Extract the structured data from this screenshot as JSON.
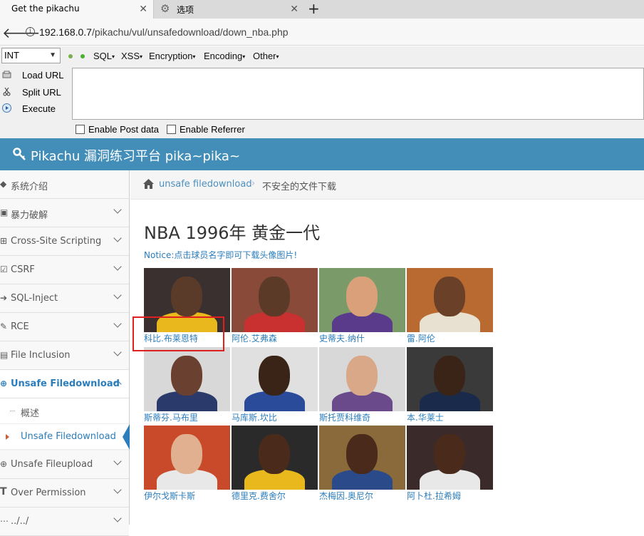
{
  "browser": {
    "tabs": [
      {
        "label": "Get the pikachu",
        "active": true
      },
      {
        "label": "选项",
        "active": false
      }
    ],
    "url_prefix": "192.168.0.7",
    "url_path": "/pikachu/vul/unsafedownload/down_nba.php"
  },
  "hackbar": {
    "select_value": "INT",
    "menus": [
      "SQL",
      "XSS",
      "Encryption",
      "Encoding",
      "Other"
    ],
    "buttons": [
      "Load URL",
      "Split URL",
      "Execute"
    ],
    "checkboxes": [
      "Enable Post data",
      "Enable Referrer"
    ]
  },
  "header": {
    "title": "Pikachu 漏洞练习平台 pika~pika~",
    "color": "#438eb9"
  },
  "sidebar": {
    "items": [
      {
        "label": "系统介绍",
        "icon": "tag-icon"
      },
      {
        "label": "暴力破解",
        "icon": "lock-icon"
      },
      {
        "label": "Cross-Site Scripting",
        "icon": "grid-icon"
      },
      {
        "label": "CSRF",
        "icon": "edit-icon"
      },
      {
        "label": "SQL-Inject",
        "icon": "arrow-icon"
      },
      {
        "label": "RCE",
        "icon": "pencil-icon"
      },
      {
        "label": "File Inclusion",
        "icon": "file-icon"
      },
      {
        "label": "Unsafe Filedownload",
        "icon": "download-icon",
        "open": true
      },
      {
        "label": "Unsafe Fileupload",
        "icon": "upload-icon"
      },
      {
        "label": "Over Permission",
        "icon": "text-icon"
      },
      {
        "label": "../../",
        "icon": "dots-icon"
      }
    ],
    "subitems": [
      {
        "label": "概述"
      },
      {
        "label": "Unsafe Filedownload",
        "active": true
      }
    ]
  },
  "breadcrumb": {
    "link": "unsafe filedownload",
    "separator": "›",
    "current": "不安全的文件下载"
  },
  "main": {
    "title": "NBA 1996年 黄金一代",
    "notice": "Notice:点击球员名字即可下载头像图片!",
    "players": [
      {
        "name": "科比.布莱恩特",
        "bg": "#3a3030",
        "skin": "#5a3a28",
        "jersey": "#e8b81c"
      },
      {
        "name": "阿伦.艾弗森",
        "bg": "#8a4a3a",
        "skin": "#5b3a28",
        "jersey": "#c93030"
      },
      {
        "name": "史蒂夫.纳什",
        "bg": "#7a9a6a",
        "skin": "#d9a07a",
        "jersey": "#5a3a8a"
      },
      {
        "name": "雷.阿伦",
        "bg": "#b86a30",
        "skin": "#6a4028",
        "jersey": "#e8e0d0"
      },
      {
        "name": "斯蒂芬.马布里",
        "bg": "#d8d8d8",
        "skin": "#6a4030",
        "jersey": "#2a3a6a"
      },
      {
        "name": "马库斯.坎比",
        "bg": "#e0e0e0",
        "skin": "#3a2418",
        "jersey": "#2a4a9a"
      },
      {
        "name": "斯托贾科维奇",
        "bg": "#d8d8d8",
        "skin": "#d8a888",
        "jersey": "#6a4a8a"
      },
      {
        "name": "本.华莱士",
        "bg": "#3a3a3a",
        "skin": "#3a2418",
        "jersey": "#1a2a4a"
      },
      {
        "name": "伊尔戈斯卡斯",
        "bg": "#c84a2a",
        "skin": "#e0b090",
        "jersey": "#e8e8e8"
      },
      {
        "name": "德里克.费舍尔",
        "bg": "#2a2a2a",
        "skin": "#4a2a1a",
        "jersey": "#e8b81c"
      },
      {
        "name": "杰梅因.奥尼尔",
        "bg": "#8a6a3a",
        "skin": "#4a2a1a",
        "jersey": "#2a4a8a"
      },
      {
        "name": "阿卜杜.拉希姆",
        "bg": "#3a2a2a",
        "skin": "#4a2a1a",
        "jersey": "#e8e8e8"
      }
    ]
  }
}
